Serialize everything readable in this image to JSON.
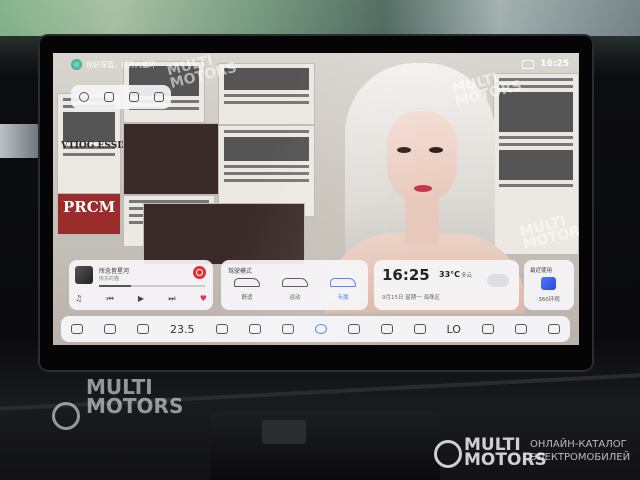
{
  "status_bar": {
    "left_text": "你好深蓝，打开内循环",
    "time": "16:25"
  },
  "music": {
    "title": "所念皆星河",
    "artist": "房东的猫",
    "progress": 0.3
  },
  "drive_mode": {
    "title": "驾驶模式",
    "modes": [
      {
        "label": "舒适"
      },
      {
        "label": "运动"
      },
      {
        "label": "专属"
      }
    ]
  },
  "clock_widget": {
    "time": "16:25",
    "temperature": "33°C",
    "weather": "多云",
    "date": "9月15日 星期一 海珠区"
  },
  "recent": {
    "title": "最近使用",
    "app_label": "360环视"
  },
  "dock": {
    "ac_temperature": "23.5",
    "fan_level": "LO"
  },
  "wallpaper_text": {
    "paper_1": "VTIOG ESSDNS",
    "paper_2": "PRCM"
  },
  "watermarks": {
    "brand_line1": "MULTI",
    "brand_line2": "MOTORS",
    "catalog_line1": "ОНЛАЙН-КАТАЛОГ",
    "catalog_line2": "ЭЛЕКТРОМОБИЛЕЙ"
  }
}
